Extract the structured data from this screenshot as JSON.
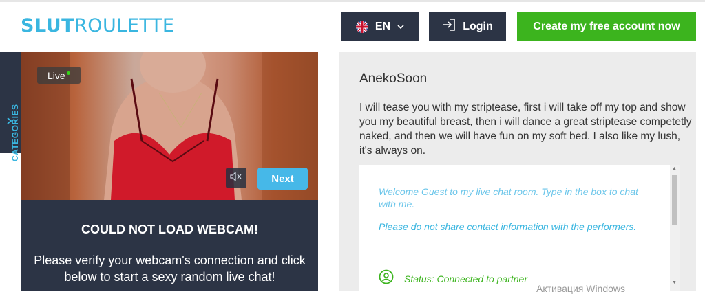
{
  "header": {
    "logo_bold": "SLUT",
    "logo_light": "ROULETTE",
    "language_label": "EN",
    "login_label": "Login",
    "create_account_label": "Create my free account now"
  },
  "sidebar": {
    "categories_label": "CATEGORIES"
  },
  "video": {
    "live_label": "Live",
    "next_label": "Next"
  },
  "webcam_error": {
    "title": "COULD NOT LOAD WEBCAM!",
    "message": "Please verify your webcam's connection and click below to start a sexy random live chat!"
  },
  "performer": {
    "name": "AnekoSoon",
    "description": "I will tease you with my striptease, first i will take off my top and show you my beautiful breast, then i will dance a great striptease competetly naked, and then we will have fun on my soft bed. I also like my lush, it's always on."
  },
  "chat": {
    "messages": [
      "Welcome Guest to my live chat room. Type in the box to chat with me.",
      "Please do not share contact information with the performers."
    ],
    "status": "Status: Connected to partner"
  },
  "overlay": {
    "watermark": "Активация Windows"
  },
  "colors": {
    "brand_blue": "#3ab6e0",
    "dark_navy": "#2c3445",
    "accent_green": "#3cb41e",
    "panel_gray": "#ececec"
  },
  "icons": {
    "language_flag": "uk-flag-icon",
    "language_caret": "chevron-down-icon",
    "login": "login-icon",
    "mute": "speaker-muted-icon",
    "status": "user-connected-icon"
  }
}
